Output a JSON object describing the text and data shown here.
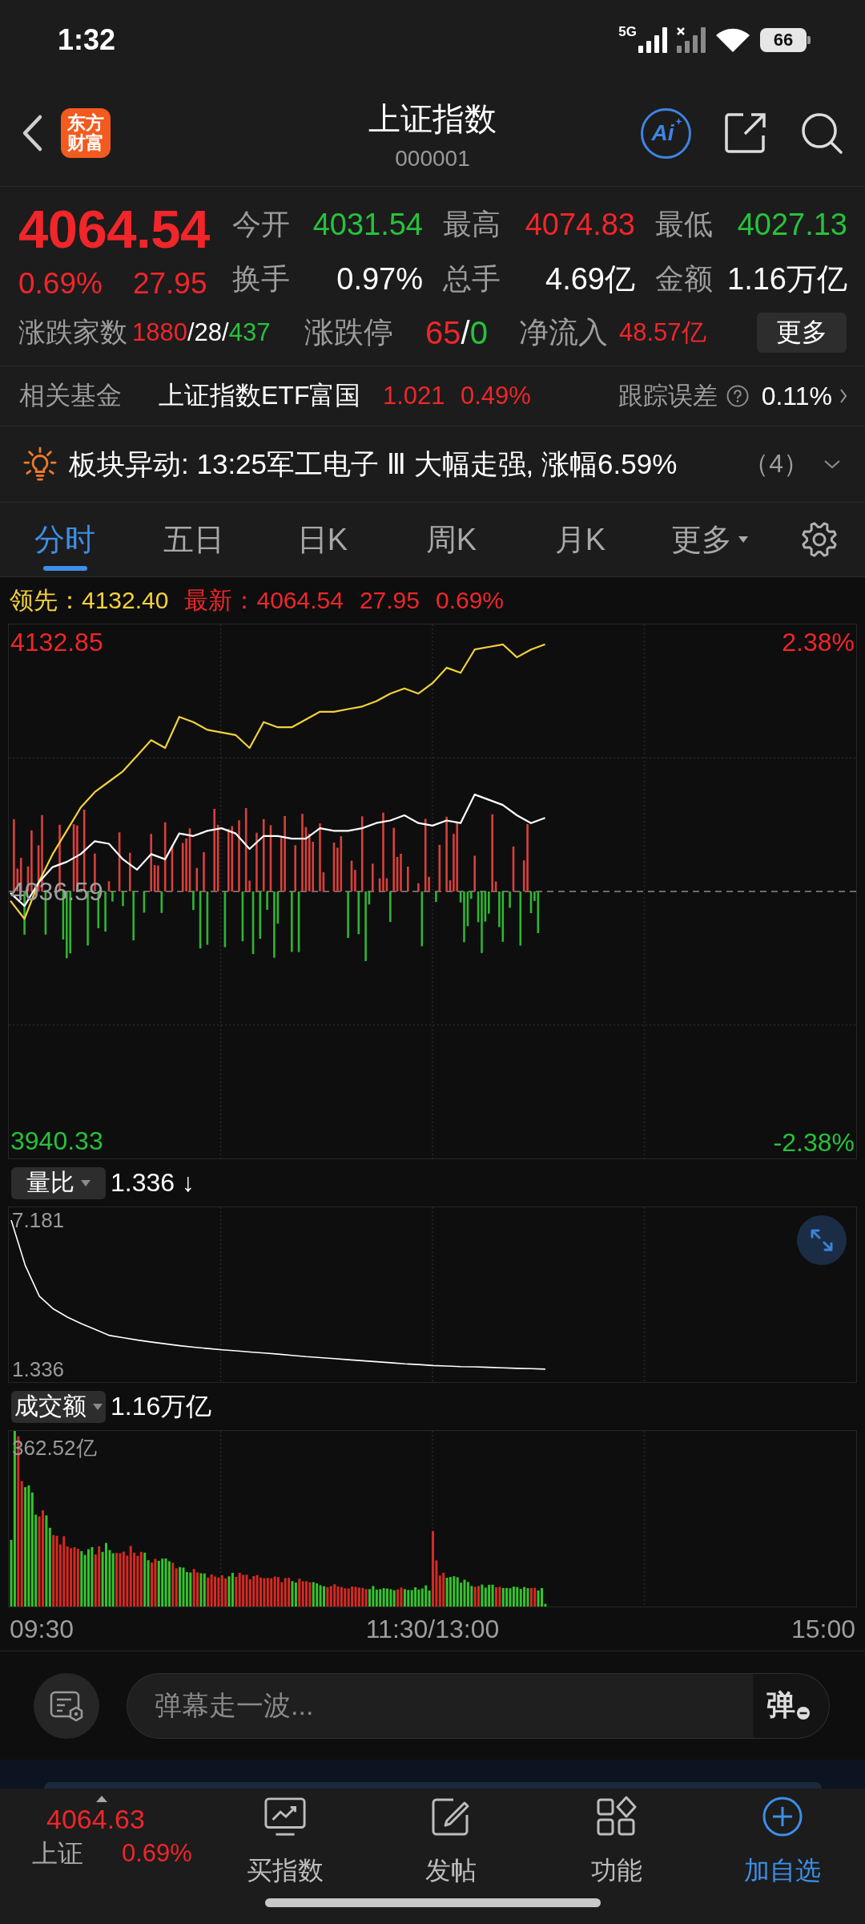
{
  "status_bar": {
    "time": "1:32",
    "network": "5G",
    "battery": "66"
  },
  "header": {
    "logo": "东方财富",
    "title": "上证指数",
    "code": "000001",
    "ai": "Ai"
  },
  "quote": {
    "price": "4064.54",
    "change_pct": "0.69%",
    "change": "27.95",
    "rising": true,
    "stats": [
      {
        "label": "今开",
        "value": "4031.54",
        "color": "#27c23b"
      },
      {
        "label": "最高",
        "value": "4074.83",
        "color": "#f0262a"
      },
      {
        "label": "最低",
        "value": "4027.13",
        "color": "#27c23b"
      },
      {
        "label": "换手",
        "value": "0.97%",
        "color": "#ffffff"
      },
      {
        "label": "总手",
        "value": "4.69亿",
        "color": "#ffffff"
      },
      {
        "label": "金额",
        "value": "1.16万亿",
        "color": "#ffffff"
      }
    ],
    "breadth": [
      {
        "label": "涨跌家数",
        "parts": [
          {
            "text": "1880",
            "color": "#f0262a"
          },
          {
            "text": "/28/",
            "color": "#ffffff"
          },
          {
            "text": "437",
            "color": "#27c23b"
          }
        ]
      },
      {
        "label": "涨跌停",
        "parts": [
          {
            "text": "65",
            "color": "#f0262a"
          },
          {
            "text": "/",
            "color": "#ffffff"
          },
          {
            "text": "0",
            "color": "#27c23b"
          }
        ]
      },
      {
        "label": "净流入",
        "parts": [
          {
            "text": "48.57亿",
            "color": "#f0262a"
          }
        ]
      }
    ],
    "more": "更多"
  },
  "fund": {
    "label": "相关基金",
    "name": "上证指数ETF富国",
    "price": "1.021",
    "change": "0.49%",
    "rising": true,
    "tracking_label": "跟踪误差",
    "tracking_value": "0.11%"
  },
  "alert": {
    "text": "板块异动: 13:25军工电子 Ⅲ 大幅走强, 涨幅6.59%",
    "count": "（4）",
    "expanded": false
  },
  "tabs": [
    {
      "label": "分时",
      "selected": true,
      "kind": "tab"
    },
    {
      "label": "五日",
      "selected": false,
      "kind": "tab"
    },
    {
      "label": "日K",
      "selected": false,
      "kind": "tab"
    },
    {
      "label": "周K",
      "selected": false,
      "kind": "tab"
    },
    {
      "label": "月K",
      "selected": false,
      "kind": "tab"
    },
    {
      "label": "更多",
      "selected": false,
      "kind": "menu"
    }
  ],
  "legend": [
    {
      "text": "领先：4132.40",
      "color": "#f3d13b"
    },
    {
      "text": "最新：4064.54",
      "color": "#f0262a"
    },
    {
      "text": "27.95",
      "color": "#f0262a"
    },
    {
      "text": "0.69%",
      "color": "#f0262a"
    }
  ],
  "price_chart": {
    "pct_labels": [
      {
        "text": "2.38%",
        "color": "#f0262a"
      },
      {
        "text": "-2.38%",
        "color": "#27c23b"
      }
    ],
    "chart_data": {
      "type": "line",
      "grid": true,
      "categories": [
        null,
        null,
        null,
        null,
        null,
        null,
        null,
        null,
        null,
        null,
        null,
        null,
        null,
        null,
        null,
        null,
        null,
        null,
        null,
        null,
        null,
        null,
        null,
        null,
        null,
        null,
        null,
        null,
        null,
        null,
        null,
        null,
        null,
        null,
        null,
        null,
        null,
        null,
        null,
        null,
        null,
        null,
        null,
        null,
        null,
        null,
        null,
        null,
        null,
        null,
        null,
        null,
        null,
        null,
        null,
        null,
        null,
        null,
        null,
        null,
        null
      ],
      "ylim": [
        3933.51,
        4139.67
      ],
      "yticks": [
        {
          "value": 4132.85,
          "label": "4132.85"
        },
        {
          "value": 4036.59,
          "label": "4036.59"
        },
        {
          "value": 3940.33,
          "label": "3940.33"
        }
      ],
      "series": [
        {
          "color": "#f3d13b",
          "values": [
            4033,
            4026,
            4040,
            4051,
            4060,
            4069,
            4075,
            4079,
            4083,
            4089,
            4095,
            4092,
            4104,
            4102,
            4099,
            4098,
            4097,
            4092,
            4102,
            4100,
            4100,
            4103,
            4106,
            4106,
            4107,
            4108,
            4110,
            4113,
            4115,
            4113,
            4117,
            4123,
            4121,
            4130,
            4131,
            4132,
            4127,
            4130,
            4132,
            null,
            null,
            null,
            null,
            null,
            null,
            null,
            null,
            null,
            null,
            null,
            null,
            null,
            null,
            null,
            null,
            null,
            null,
            null,
            null,
            null,
            null
          ]
        },
        {
          "color": "#ffffff",
          "values": [
            4036,
            4031,
            4040,
            4046,
            4048,
            4051,
            4056,
            4055,
            4049,
            4045,
            4051,
            4049,
            4059,
            4058,
            4060,
            4061,
            4059,
            4053,
            4058,
            4058,
            4057,
            4057,
            4061,
            4060,
            4060,
            4061,
            4063,
            4064,
            4066,
            4063,
            4062,
            4064,
            4063,
            4074,
            4072,
            4070,
            4066,
            4063,
            4065,
            null,
            null,
            null,
            null,
            null,
            null,
            null,
            null,
            null,
            null,
            null,
            null,
            null,
            null,
            null,
            null,
            null,
            null,
            null,
            null,
            null,
            null
          ]
        }
      ]
    }
  },
  "ratio_panel": {
    "selector": "量比",
    "value": "1.336 ↓",
    "chart_data": {
      "type": "line",
      "grid": true,
      "categories": [
        null,
        null,
        null,
        null,
        null,
        null,
        null,
        null,
        null,
        null,
        null,
        null,
        null,
        null,
        null,
        null,
        null,
        null,
        null,
        null,
        null,
        null,
        null,
        null,
        null,
        null,
        null,
        null,
        null,
        null,
        null,
        null,
        null,
        null,
        null,
        null,
        null,
        null,
        null,
        null,
        null,
        null,
        null,
        null,
        null,
        null,
        null,
        null,
        null,
        null,
        null,
        null,
        null,
        null,
        null,
        null,
        null,
        null,
        null,
        null,
        null
      ],
      "ylim": [
        0.833,
        7.684
      ],
      "yticks": [
        {
          "value": 7.181,
          "label": "7.181"
        },
        {
          "value": 1.336,
          "label": "1.336"
        }
      ],
      "series": [
        {
          "color": "#ffffff",
          "values": [
            7.18,
            5.4,
            4.2,
            3.7,
            3.38,
            3.12,
            2.89,
            2.66,
            2.57,
            2.48,
            2.4,
            2.33,
            2.26,
            2.2,
            2.15,
            2.1,
            2.06,
            2.01,
            1.97,
            1.93,
            1.88,
            1.83,
            1.79,
            1.75,
            1.71,
            1.67,
            1.63,
            1.59,
            1.55,
            1.52,
            1.48,
            1.46,
            1.44,
            1.43,
            1.41,
            1.39,
            1.37,
            1.36,
            1.34,
            null,
            null,
            null,
            null,
            null,
            null,
            null,
            null,
            null,
            null,
            null,
            null,
            null,
            null,
            null,
            null,
            null,
            null,
            null,
            null,
            null,
            null
          ]
        }
      ]
    }
  },
  "turnover_panel": {
    "selector": "成交额",
    "value": "1.16万亿",
    "max_label": "362.52亿"
  },
  "time_axis": [
    "09:30",
    "11:30/13:00",
    "15:00"
  ],
  "comment_bar": {
    "placeholder": "弹幕走一波...",
    "toggle": "弹"
  },
  "bottom_nav": {
    "index": {
      "price": "4064.63",
      "name": "上证",
      "change": "0.69%",
      "rising": true
    },
    "items": [
      {
        "label": "买指数",
        "kind": "chart"
      },
      {
        "label": "发帖",
        "kind": "post"
      },
      {
        "label": "功能",
        "kind": "apps"
      },
      {
        "label": "加自选",
        "kind": "add"
      }
    ]
  }
}
